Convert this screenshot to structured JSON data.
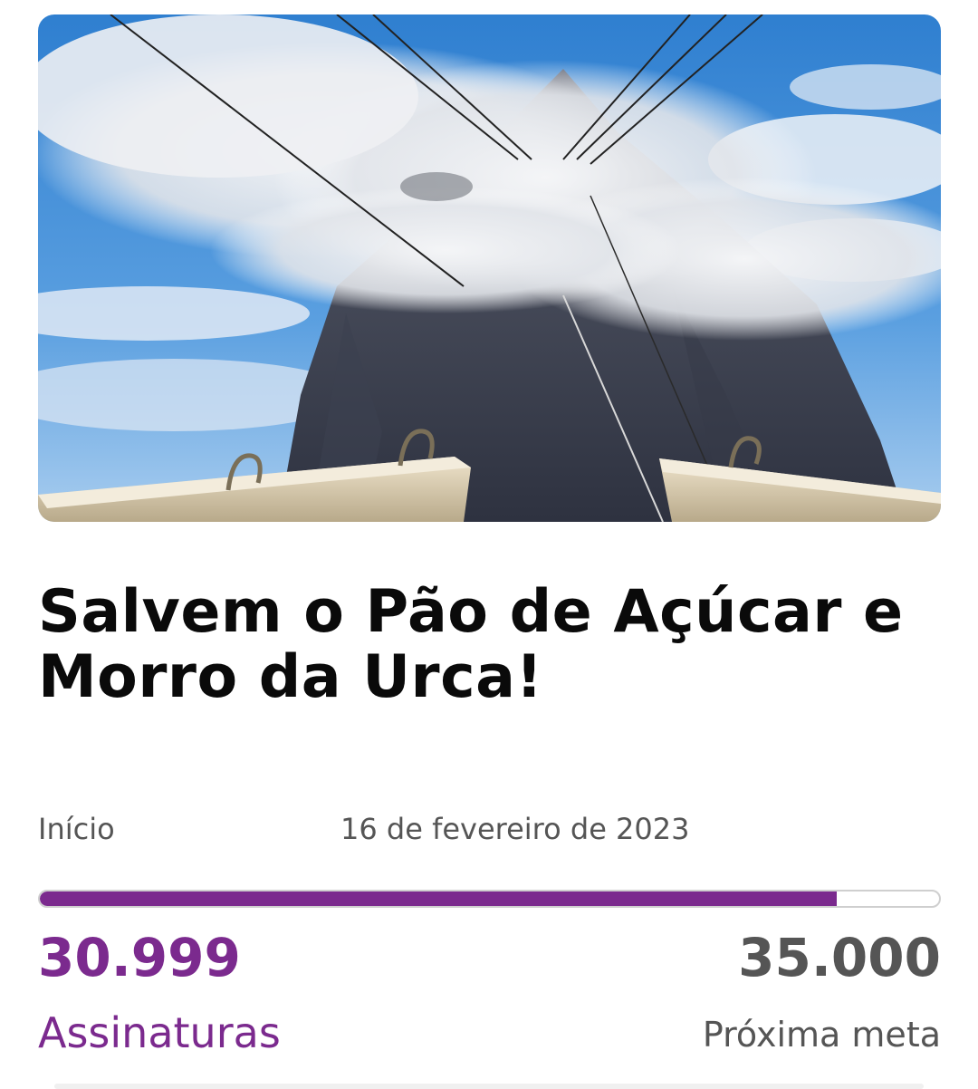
{
  "petition": {
    "image_alt": "Pão de Açúcar com nuvem e cabos do bondinho",
    "title": "Salvem o Pão de Açúcar e Morro da Urca!",
    "start_label": "Início",
    "start_date": "16 de fevereiro de 2023",
    "signatures": {
      "count": "30.999",
      "label": "Assinaturas"
    },
    "goal": {
      "count": "35.000",
      "label": "Próxima meta"
    },
    "progress_fraction": 0.8857
  },
  "colors": {
    "accent": "#7b2a8e",
    "muted_text": "#555555",
    "title_text": "#0a0a0a"
  }
}
